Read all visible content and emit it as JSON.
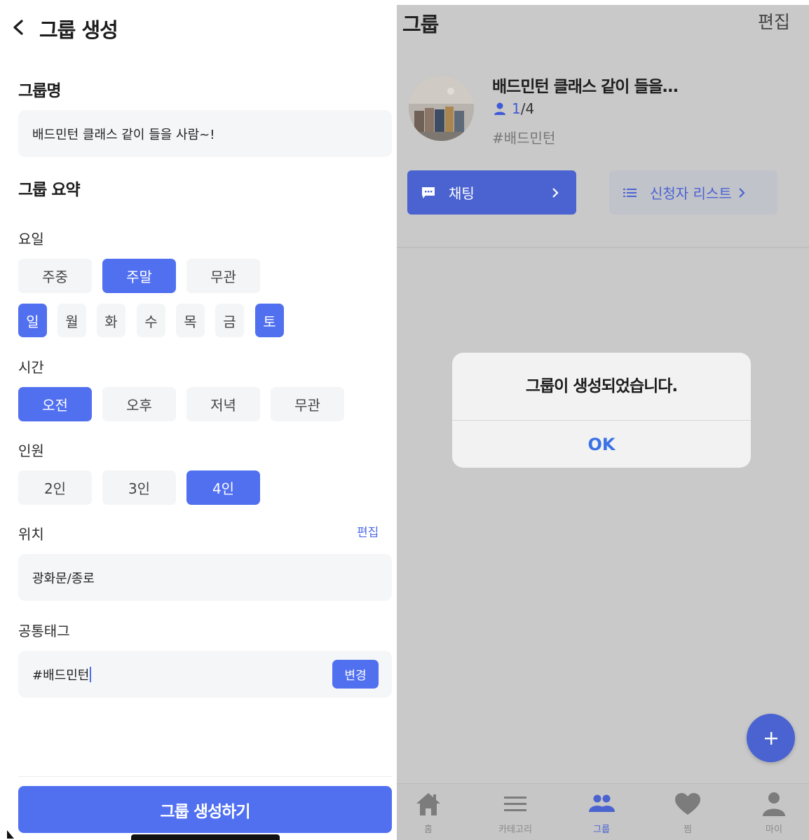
{
  "left": {
    "header": {
      "title": "그룹 생성"
    },
    "group_name": {
      "label": "그룹명",
      "value": "배드민턴 클래스 같이 들을 사람~!"
    },
    "summary": {
      "label": "그룹 요약"
    },
    "weekday": {
      "label": "요일",
      "options": [
        {
          "label": "주중",
          "selected": false
        },
        {
          "label": "주말",
          "selected": true
        },
        {
          "label": "무관",
          "selected": false
        }
      ],
      "days": [
        {
          "label": "일",
          "selected": true
        },
        {
          "label": "월",
          "selected": false
        },
        {
          "label": "화",
          "selected": false
        },
        {
          "label": "수",
          "selected": false
        },
        {
          "label": "목",
          "selected": false
        },
        {
          "label": "금",
          "selected": false
        },
        {
          "label": "토",
          "selected": true
        }
      ]
    },
    "time": {
      "label": "시간",
      "options": [
        {
          "label": "오전",
          "selected": true
        },
        {
          "label": "오후",
          "selected": false
        },
        {
          "label": "저녁",
          "selected": false
        },
        {
          "label": "무관",
          "selected": false
        }
      ]
    },
    "people": {
      "label": "인원",
      "options": [
        {
          "label": "2인",
          "selected": false
        },
        {
          "label": "3인",
          "selected": false
        },
        {
          "label": "4인",
          "selected": true
        }
      ]
    },
    "location": {
      "label": "위치",
      "edit_label": "편집",
      "value": "광화문/종로"
    },
    "tag": {
      "label": "공통태그",
      "value": "#배드민턴",
      "change_label": "변경"
    },
    "create_button": "그룹 생성하기"
  },
  "right": {
    "header": {
      "title": "그룹",
      "edit_label": "편집"
    },
    "group": {
      "name": "배드민턴 클래스 같이 들을…",
      "count_current": "1",
      "count_sep_total": "/4",
      "tag": "#배드민턴"
    },
    "chat_button": "채팅",
    "applicants_button": "신청자 리스트",
    "dialog": {
      "message": "그룹이 생성되었습니다.",
      "ok": "OK"
    },
    "tabs": [
      {
        "label": "홈",
        "icon": "home-icon",
        "active": false
      },
      {
        "label": "카테고리",
        "icon": "menu-icon",
        "active": false
      },
      {
        "label": "그룹",
        "icon": "group-icon",
        "active": true
      },
      {
        "label": "찜",
        "icon": "heart-icon",
        "active": false
      },
      {
        "label": "마이",
        "icon": "person-icon",
        "active": false
      }
    ]
  },
  "colors": {
    "accent": "#5170f0",
    "accent_dim": "#4a63d0",
    "ok_blue": "#3a72e6",
    "chip_bg": "#f4f5f7",
    "overlay_bg": "#c9c9c9"
  }
}
